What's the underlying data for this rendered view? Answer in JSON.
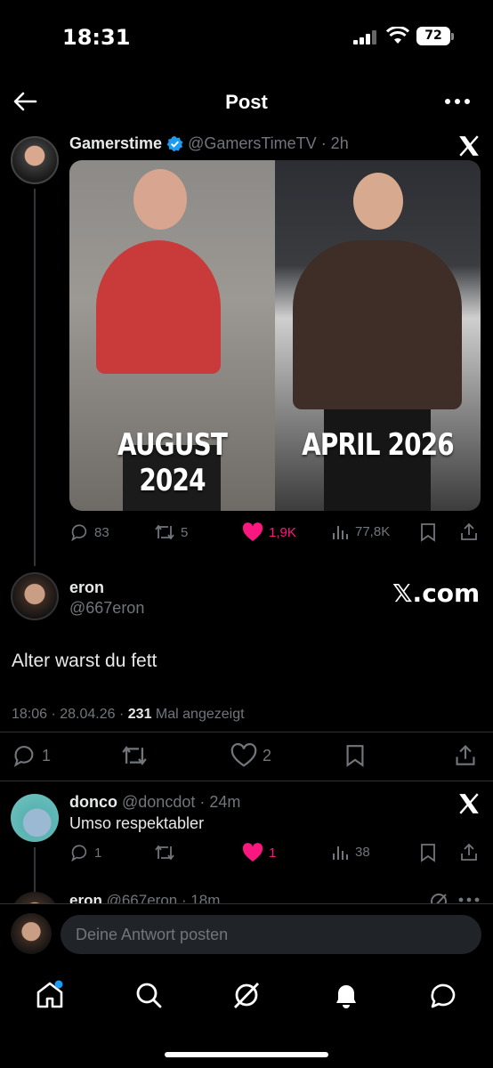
{
  "status": {
    "time": "18:31",
    "battery": "72"
  },
  "header": {
    "title": "Post"
  },
  "quoted_post": {
    "name": "Gamerstime",
    "handle": "@GamersTimeTV",
    "time": "· 2h",
    "caption_left": "AUGUST 2024",
    "caption_right": "APRIL 2026",
    "replies": "83",
    "reposts": "5",
    "likes": "1,9K",
    "views": "77,8K"
  },
  "main_post": {
    "name": "eron",
    "handle": "@667eron",
    "watermark": "𝕏.com",
    "text": "Alter warst du fett",
    "meta_time": "18:06 · 28.04.26 · ",
    "meta_views": "231",
    "meta_suffix": " Mal angezeigt",
    "replies": "1",
    "likes": "2"
  },
  "reply_post": {
    "name": "donco",
    "handle": "@doncdot",
    "time": "· 24m",
    "text": "Umso respektabler",
    "replies": "1",
    "likes": "1",
    "views": "38"
  },
  "next_post": {
    "name": "eron",
    "handle": "@667eron",
    "time": "· 18m"
  },
  "reply_bar": {
    "placeholder": "Deine Antwort posten"
  },
  "colors": {
    "like": "#f91880",
    "verified": "#1d9bf0",
    "muted": "#71767b",
    "notif_dot": "#1d9bf0"
  }
}
